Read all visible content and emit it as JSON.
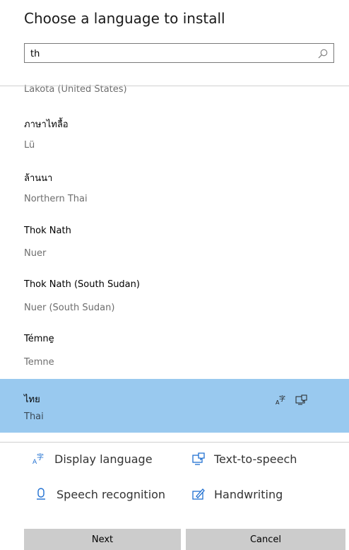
{
  "dialog": {
    "title": "Choose a language to install"
  },
  "search": {
    "value": "th"
  },
  "languages": [
    {
      "native": "",
      "english": "Lakota (United States)"
    },
    {
      "native": "ภาษาไทลื้อ",
      "english": "Lü"
    },
    {
      "native": "ล้านนา",
      "english": "Northern Thai"
    },
    {
      "native": "Thok Nath",
      "english": "Nuer"
    },
    {
      "native": "Thok Nath (South Sudan)",
      "english": "Nuer (South Sudan)"
    },
    {
      "native": "Témne̱",
      "english": "Temne"
    },
    {
      "native": "ไทย",
      "english": "Thai",
      "selected": true
    }
  ],
  "features": {
    "display_language": "Display language",
    "text_to_speech": "Text-to-speech",
    "speech_recognition": "Speech recognition",
    "handwriting": "Handwriting"
  },
  "buttons": {
    "next": "Next",
    "cancel": "Cancel"
  },
  "colors": {
    "selected_bg": "#99c9ef",
    "feature_icon": "#1f6fd1"
  }
}
